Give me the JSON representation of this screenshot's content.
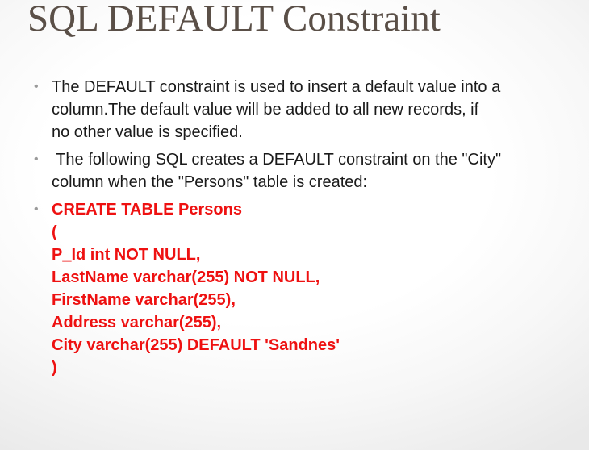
{
  "slide": {
    "title": "SQL DEFAULT Constraint",
    "bullets": [
      {
        "lines": [
          "The DEFAULT constraint is used to insert a default value into a",
          "column.The default value will be added to all new records, if",
          "no other value is specified."
        ]
      },
      {
        "lines": [
          " The following SQL creates a DEFAULT constraint on the \"City\"",
          "column when the \"Persons\" table is created:"
        ]
      }
    ],
    "code_lines": [
      "CREATE TABLE Persons",
      "(",
      "P_Id int NOT NULL,",
      "LastName varchar(255) NOT NULL,",
      "FirstName varchar(255),",
      "Address varchar(255),",
      "City varchar(255) DEFAULT 'Sandnes'",
      ")"
    ]
  },
  "colors": {
    "title": "#5a4f47",
    "body_text": "#1a1a1a",
    "code_text": "#ee1111",
    "bullet_marker": "#9a9a9a"
  }
}
